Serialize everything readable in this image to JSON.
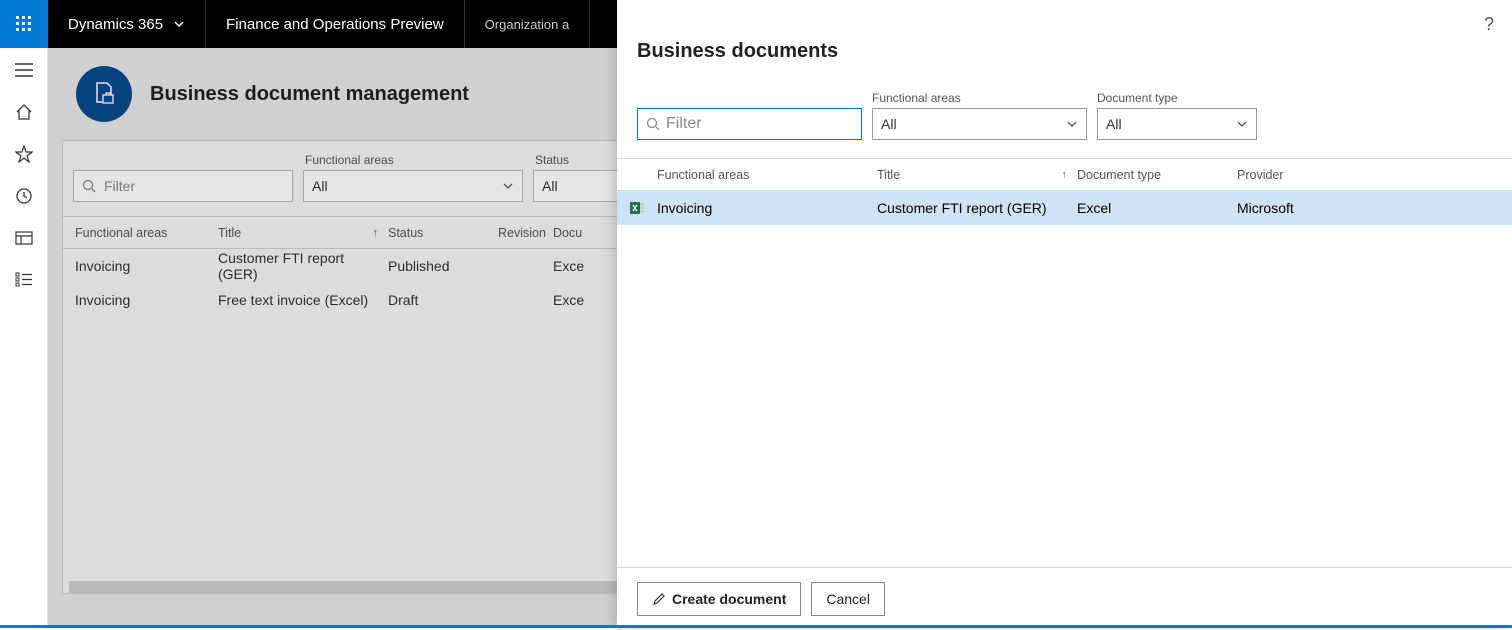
{
  "topbar": {
    "product": "Dynamics 365",
    "subtitle": "Finance and Operations Preview",
    "breadcrumb": "Organization a"
  },
  "page": {
    "title": "Business document management",
    "filters": {
      "filter_placeholder": "Filter",
      "functional_areas_label": "Functional areas",
      "functional_areas_value": "All",
      "status_label": "Status",
      "status_value": "All"
    },
    "columns": {
      "functional_areas": "Functional areas",
      "title": "Title",
      "status": "Status",
      "revision": "Revision",
      "document": "Docu"
    },
    "rows": [
      {
        "fa": "Invoicing",
        "title": "Customer FTI report (GER)",
        "status": "Published",
        "doc": "Exce"
      },
      {
        "fa": "Invoicing",
        "title": "Free text invoice (Excel)",
        "status": "Draft",
        "doc": "Exce"
      }
    ]
  },
  "modal": {
    "title": "Business documents",
    "filter_placeholder": "Filter",
    "functional_areas_label": "Functional areas",
    "functional_areas_value": "All",
    "document_type_label": "Document type",
    "document_type_value": "All",
    "columns": {
      "fa": "Functional areas",
      "title": "Title",
      "doc": "Document type",
      "provider": "Provider"
    },
    "row": {
      "fa": "Invoicing",
      "title": "Customer FTI report (GER)",
      "doc": "Excel",
      "provider": "Microsoft"
    },
    "create_button": "Create document",
    "cancel_button": "Cancel",
    "help": "?"
  }
}
